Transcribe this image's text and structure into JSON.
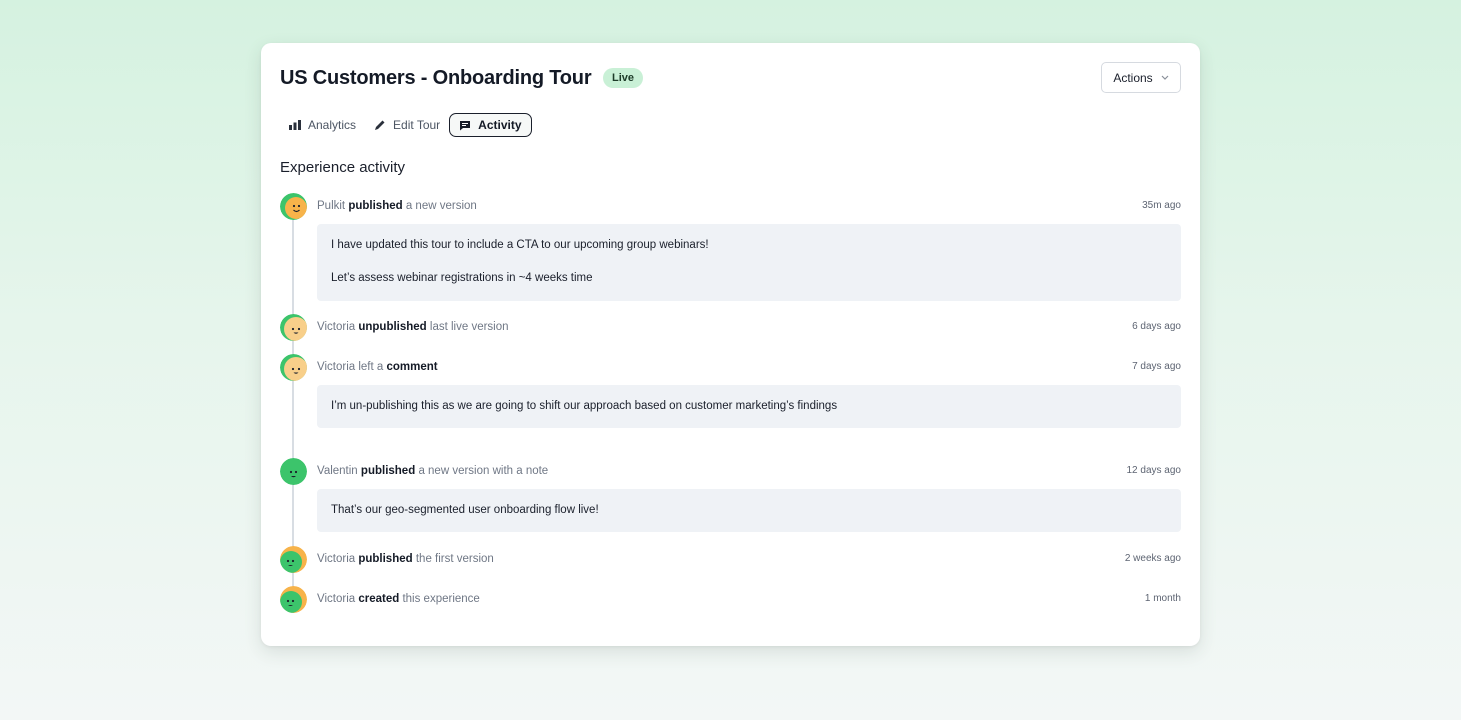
{
  "header": {
    "title": "US Customers - Onboarding Tour",
    "status_badge": "Live",
    "actions_label": "Actions"
  },
  "tabs": [
    {
      "label": "Analytics",
      "icon": "bar-chart-icon",
      "active": false
    },
    {
      "label": "Edit Tour",
      "icon": "pencil-icon",
      "active": false
    },
    {
      "label": "Activity",
      "icon": "chat-bubble-icon",
      "active": true
    }
  ],
  "section_title": "Experience activity",
  "activity": [
    {
      "user": "Pulkit",
      "action": "published",
      "rest": "a new version",
      "time": "35m ago",
      "note": [
        "I have updated this tour to include a CTA to our upcoming group webinars!",
        "Let’s assess webinar registrations in ~4 weeks time"
      ]
    },
    {
      "user": "Victoria",
      "action": "unpublished",
      "rest": "last live version",
      "time": "6 days ago"
    },
    {
      "user": "Victoria",
      "prefix": "left a",
      "action": "comment",
      "time": "7 days ago",
      "note": [
        "I’m un-publishing this as we are going to shift our approach based on customer marketing’s findings"
      ]
    },
    {
      "user": "Valentin",
      "action": "published",
      "rest": "a new version with a note",
      "time": "12 days ago",
      "note": [
        "That’s our geo-segmented user onboarding flow live!"
      ]
    },
    {
      "user": "Victoria",
      "action": "published",
      "rest": "the first version",
      "time": "2 weeks ago"
    },
    {
      "user": "Victoria",
      "action": "created",
      "rest": "this experience",
      "time": "1 month"
    }
  ],
  "colors": {
    "live_badge_bg": "#c9f0d6",
    "note_bg": "#eff2f6",
    "avatar_green": "#3cc46b",
    "avatar_orange": "#f7b34a"
  }
}
